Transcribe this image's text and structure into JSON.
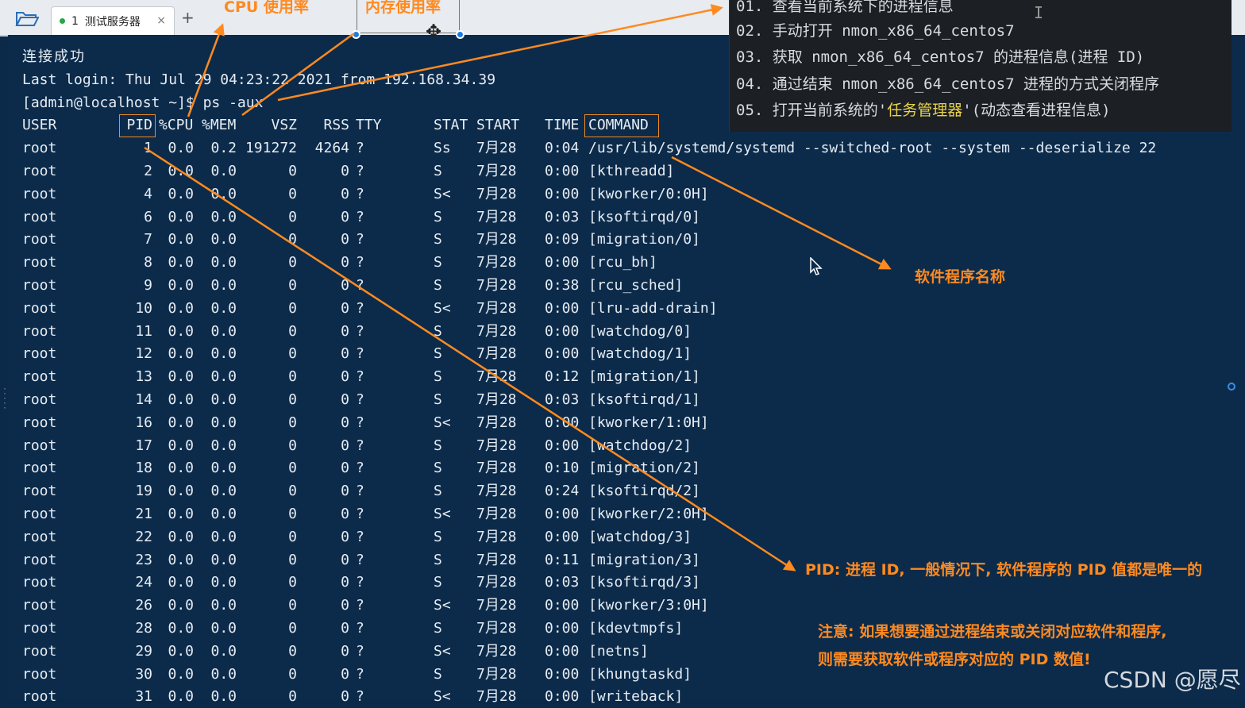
{
  "tab": {
    "number": "1",
    "title": "测试服务器",
    "close": "×",
    "add": "+"
  },
  "terminal": {
    "connect_msg": "连接成功",
    "last_login": "Last login: Thu Jul 29 04:23:22 2021 from 192.168.34.39",
    "prompt": "[admin@localhost ~]$ ps -aux",
    "headers": {
      "user": "USER",
      "pid": "PID",
      "cpu": "%CPU",
      "mem": "%MEM",
      "vsz": "VSZ",
      "rss": "RSS",
      "tty": "TTY",
      "stat": "STAT",
      "start": "START",
      "time": "TIME",
      "command": "COMMAND"
    },
    "rows": [
      {
        "user": "root",
        "pid": "1",
        "cpu": "0.0",
        "mem": "0.2",
        "vsz": "191272",
        "rss": "4264",
        "tty": "?",
        "stat": "Ss",
        "start": "7月28",
        "time": "0:04",
        "command": "/usr/lib/systemd/systemd --switched-root --system --deserialize 22"
      },
      {
        "user": "root",
        "pid": "2",
        "cpu": "0.0",
        "mem": "0.0",
        "vsz": "0",
        "rss": "0",
        "tty": "?",
        "stat": "S",
        "start": "7月28",
        "time": "0:00",
        "command": "[kthreadd]"
      },
      {
        "user": "root",
        "pid": "4",
        "cpu": "0.0",
        "mem": "0.0",
        "vsz": "0",
        "rss": "0",
        "tty": "?",
        "stat": "S<",
        "start": "7月28",
        "time": "0:00",
        "command": "[kworker/0:0H]"
      },
      {
        "user": "root",
        "pid": "6",
        "cpu": "0.0",
        "mem": "0.0",
        "vsz": "0",
        "rss": "0",
        "tty": "?",
        "stat": "S",
        "start": "7月28",
        "time": "0:03",
        "command": "[ksoftirqd/0]"
      },
      {
        "user": "root",
        "pid": "7",
        "cpu": "0.0",
        "mem": "0.0",
        "vsz": "0",
        "rss": "0",
        "tty": "?",
        "stat": "S",
        "start": "7月28",
        "time": "0:09",
        "command": "[migration/0]"
      },
      {
        "user": "root",
        "pid": "8",
        "cpu": "0.0",
        "mem": "0.0",
        "vsz": "0",
        "rss": "0",
        "tty": "?",
        "stat": "S",
        "start": "7月28",
        "time": "0:00",
        "command": "[rcu_bh]"
      },
      {
        "user": "root",
        "pid": "9",
        "cpu": "0.0",
        "mem": "0.0",
        "vsz": "0",
        "rss": "0",
        "tty": "?",
        "stat": "S",
        "start": "7月28",
        "time": "0:38",
        "command": "[rcu_sched]"
      },
      {
        "user": "root",
        "pid": "10",
        "cpu": "0.0",
        "mem": "0.0",
        "vsz": "0",
        "rss": "0",
        "tty": "?",
        "stat": "S<",
        "start": "7月28",
        "time": "0:00",
        "command": "[lru-add-drain]"
      },
      {
        "user": "root",
        "pid": "11",
        "cpu": "0.0",
        "mem": "0.0",
        "vsz": "0",
        "rss": "0",
        "tty": "?",
        "stat": "S",
        "start": "7月28",
        "time": "0:00",
        "command": "[watchdog/0]"
      },
      {
        "user": "root",
        "pid": "12",
        "cpu": "0.0",
        "mem": "0.0",
        "vsz": "0",
        "rss": "0",
        "tty": "?",
        "stat": "S",
        "start": "7月28",
        "time": "0:00",
        "command": "[watchdog/1]"
      },
      {
        "user": "root",
        "pid": "13",
        "cpu": "0.0",
        "mem": "0.0",
        "vsz": "0",
        "rss": "0",
        "tty": "?",
        "stat": "S",
        "start": "7月28",
        "time": "0:12",
        "command": "[migration/1]"
      },
      {
        "user": "root",
        "pid": "14",
        "cpu": "0.0",
        "mem": "0.0",
        "vsz": "0",
        "rss": "0",
        "tty": "?",
        "stat": "S",
        "start": "7月28",
        "time": "0:03",
        "command": "[ksoftirqd/1]"
      },
      {
        "user": "root",
        "pid": "16",
        "cpu": "0.0",
        "mem": "0.0",
        "vsz": "0",
        "rss": "0",
        "tty": "?",
        "stat": "S<",
        "start": "7月28",
        "time": "0:00",
        "command": "[kworker/1:0H]"
      },
      {
        "user": "root",
        "pid": "17",
        "cpu": "0.0",
        "mem": "0.0",
        "vsz": "0",
        "rss": "0",
        "tty": "?",
        "stat": "S",
        "start": "7月28",
        "time": "0:00",
        "command": "[watchdog/2]"
      },
      {
        "user": "root",
        "pid": "18",
        "cpu": "0.0",
        "mem": "0.0",
        "vsz": "0",
        "rss": "0",
        "tty": "?",
        "stat": "S",
        "start": "7月28",
        "time": "0:10",
        "command": "[migration/2]"
      },
      {
        "user": "root",
        "pid": "19",
        "cpu": "0.0",
        "mem": "0.0",
        "vsz": "0",
        "rss": "0",
        "tty": "?",
        "stat": "S",
        "start": "7月28",
        "time": "0:24",
        "command": "[ksoftirqd/2]"
      },
      {
        "user": "root",
        "pid": "21",
        "cpu": "0.0",
        "mem": "0.0",
        "vsz": "0",
        "rss": "0",
        "tty": "?",
        "stat": "S<",
        "start": "7月28",
        "time": "0:00",
        "command": "[kworker/2:0H]"
      },
      {
        "user": "root",
        "pid": "22",
        "cpu": "0.0",
        "mem": "0.0",
        "vsz": "0",
        "rss": "0",
        "tty": "?",
        "stat": "S",
        "start": "7月28",
        "time": "0:00",
        "command": "[watchdog/3]"
      },
      {
        "user": "root",
        "pid": "23",
        "cpu": "0.0",
        "mem": "0.0",
        "vsz": "0",
        "rss": "0",
        "tty": "?",
        "stat": "S",
        "start": "7月28",
        "time": "0:11",
        "command": "[migration/3]"
      },
      {
        "user": "root",
        "pid": "24",
        "cpu": "0.0",
        "mem": "0.0",
        "vsz": "0",
        "rss": "0",
        "tty": "?",
        "stat": "S",
        "start": "7月28",
        "time": "0:03",
        "command": "[ksoftirqd/3]"
      },
      {
        "user": "root",
        "pid": "26",
        "cpu": "0.0",
        "mem": "0.0",
        "vsz": "0",
        "rss": "0",
        "tty": "?",
        "stat": "S<",
        "start": "7月28",
        "time": "0:00",
        "command": "[kworker/3:0H]"
      },
      {
        "user": "root",
        "pid": "28",
        "cpu": "0.0",
        "mem": "0.0",
        "vsz": "0",
        "rss": "0",
        "tty": "?",
        "stat": "S",
        "start": "7月28",
        "time": "0:00",
        "command": "[kdevtmpfs]"
      },
      {
        "user": "root",
        "pid": "29",
        "cpu": "0.0",
        "mem": "0.0",
        "vsz": "0",
        "rss": "0",
        "tty": "?",
        "stat": "S<",
        "start": "7月28",
        "time": "0:00",
        "command": "[netns]"
      },
      {
        "user": "root",
        "pid": "30",
        "cpu": "0.0",
        "mem": "0.0",
        "vsz": "0",
        "rss": "0",
        "tty": "?",
        "stat": "S",
        "start": "7月28",
        "time": "0:00",
        "command": "[khungtaskd]"
      },
      {
        "user": "root",
        "pid": "31",
        "cpu": "0.0",
        "mem": "0.0",
        "vsz": "0",
        "rss": "0",
        "tty": "?",
        "stat": "S<",
        "start": "7月28",
        "time": "0:00",
        "command": "[writeback]"
      }
    ]
  },
  "notes_panel": {
    "items": [
      {
        "num": "01.",
        "pre": "查看当前系统下的进程信息",
        "hl": "",
        "post": ""
      },
      {
        "num": "02.",
        "pre": "手动打开 nmon_x86_64_centos7",
        "hl": "",
        "post": ""
      },
      {
        "num": "03.",
        "pre": "获取 nmon_x86_64_centos7 的进程信息(进程 ID)",
        "hl": "",
        "post": ""
      },
      {
        "num": "04.",
        "pre": "通过结束 nmon_x86_64_centos7 进程的方式关闭程序",
        "hl": "",
        "post": ""
      },
      {
        "num": "05.",
        "pre": "打开当前系统的'",
        "hl": "任务管理器",
        "post": "'(动态查看进程信息)"
      }
    ]
  },
  "annotations": {
    "cpu": "CPU 使用率",
    "mem": "内存使用率",
    "command": "软件程序名称",
    "pid": "PID: 进程 ID, 一般情况下, 软件程序的 PID 值都是唯一的",
    "note_line1": "注意: 如果想要通过进程结束或关闭对应软件和程序,",
    "note_line2": "则需要获取软件或程序对应的 PID 数值!"
  },
  "watermark": "CSDN @愿尽",
  "colors": {
    "terminal_bg": "#0c2b4b",
    "annotation": "#ff8a1f",
    "highlight": "#e8d44d"
  }
}
